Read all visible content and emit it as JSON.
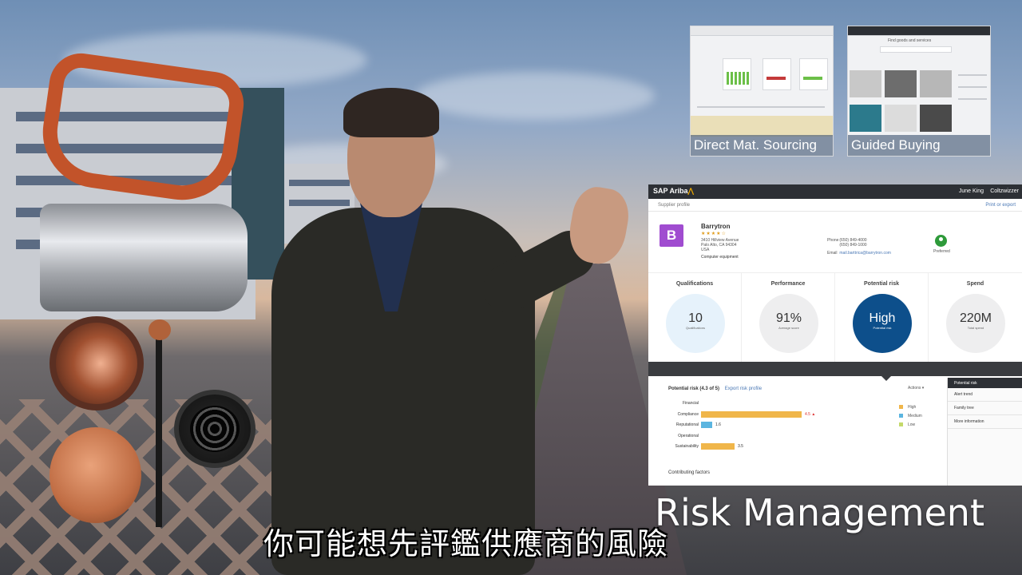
{
  "thumbnails": [
    {
      "caption": "Direct Mat. Sourcing"
    },
    {
      "caption": "Guided Buying",
      "search_placeholder": "Find goods and services"
    }
  ],
  "panel": {
    "brand_main": "SAP Ariba",
    "user_menu": "June King",
    "org_menu": "Coltzwizzer",
    "breadcrumb": "Supplier profile",
    "print_export": "Print or export",
    "supplier": {
      "avatar_letter": "B",
      "name": "Barrytron",
      "rating": "★★★★☆",
      "address_line1": "3410 Hillview Avenue",
      "address_line2": "Palo Alto, CA 94304",
      "address_line3": "USA",
      "category": "Computer equipment",
      "phone_label": "Phone",
      "phone1": "(650) 849-4000",
      "phone2": "(650) 849-1000",
      "email_label": "Email",
      "email": "mail.barttrica@barrytron.com",
      "preferred_label": "Preferred"
    },
    "metrics": [
      {
        "label": "Qualifications",
        "value": "10",
        "sub": "Qualifications",
        "style": "blue"
      },
      {
        "label": "Performance",
        "value": "91%",
        "sub": "Average score",
        "style": "gray"
      },
      {
        "label": "Potential risk",
        "value": "High",
        "sub": "Potential risk",
        "style": "dark"
      },
      {
        "label": "Spend",
        "value": "220M",
        "sub": "Total spend",
        "style": "gray"
      }
    ],
    "risk": {
      "title": "Potential risk (4.3 of 5)",
      "export": "Export risk profile",
      "actions": "Actions ▾",
      "rows": [
        {
          "label": "Financial",
          "value": null,
          "fraction": 0,
          "color": "#f0b64a",
          "value_text": ""
        },
        {
          "label": "Compliance",
          "value": 4.5,
          "fraction": 0.9,
          "color": "#f0b64a",
          "value_text": "4.5 ▲"
        },
        {
          "label": "Reputational",
          "value": 1.6,
          "fraction": 0.1,
          "color": "#5bb5e0",
          "value_text": "1.6"
        },
        {
          "label": "Operational",
          "value": null,
          "fraction": 0,
          "color": "#f0b64a",
          "value_text": ""
        },
        {
          "label": "Sustainability",
          "value": 3.5,
          "fraction": 0.3,
          "color": "#f0b64a",
          "value_text": "3.5"
        }
      ],
      "legend": [
        {
          "label": "High",
          "color": "#f0b64a"
        },
        {
          "label": "Medium",
          "color": "#5bb5e0"
        },
        {
          "label": "Low",
          "color": "#c4d96a"
        }
      ],
      "contributing": "Contributing factors"
    },
    "side_menu": {
      "header": "Potential risk",
      "items": [
        "Alert trend",
        "Family tree",
        "More information"
      ]
    }
  },
  "overlay_title": "Risk Management",
  "subtitle": "你可能想先評鑑供應商的風險"
}
